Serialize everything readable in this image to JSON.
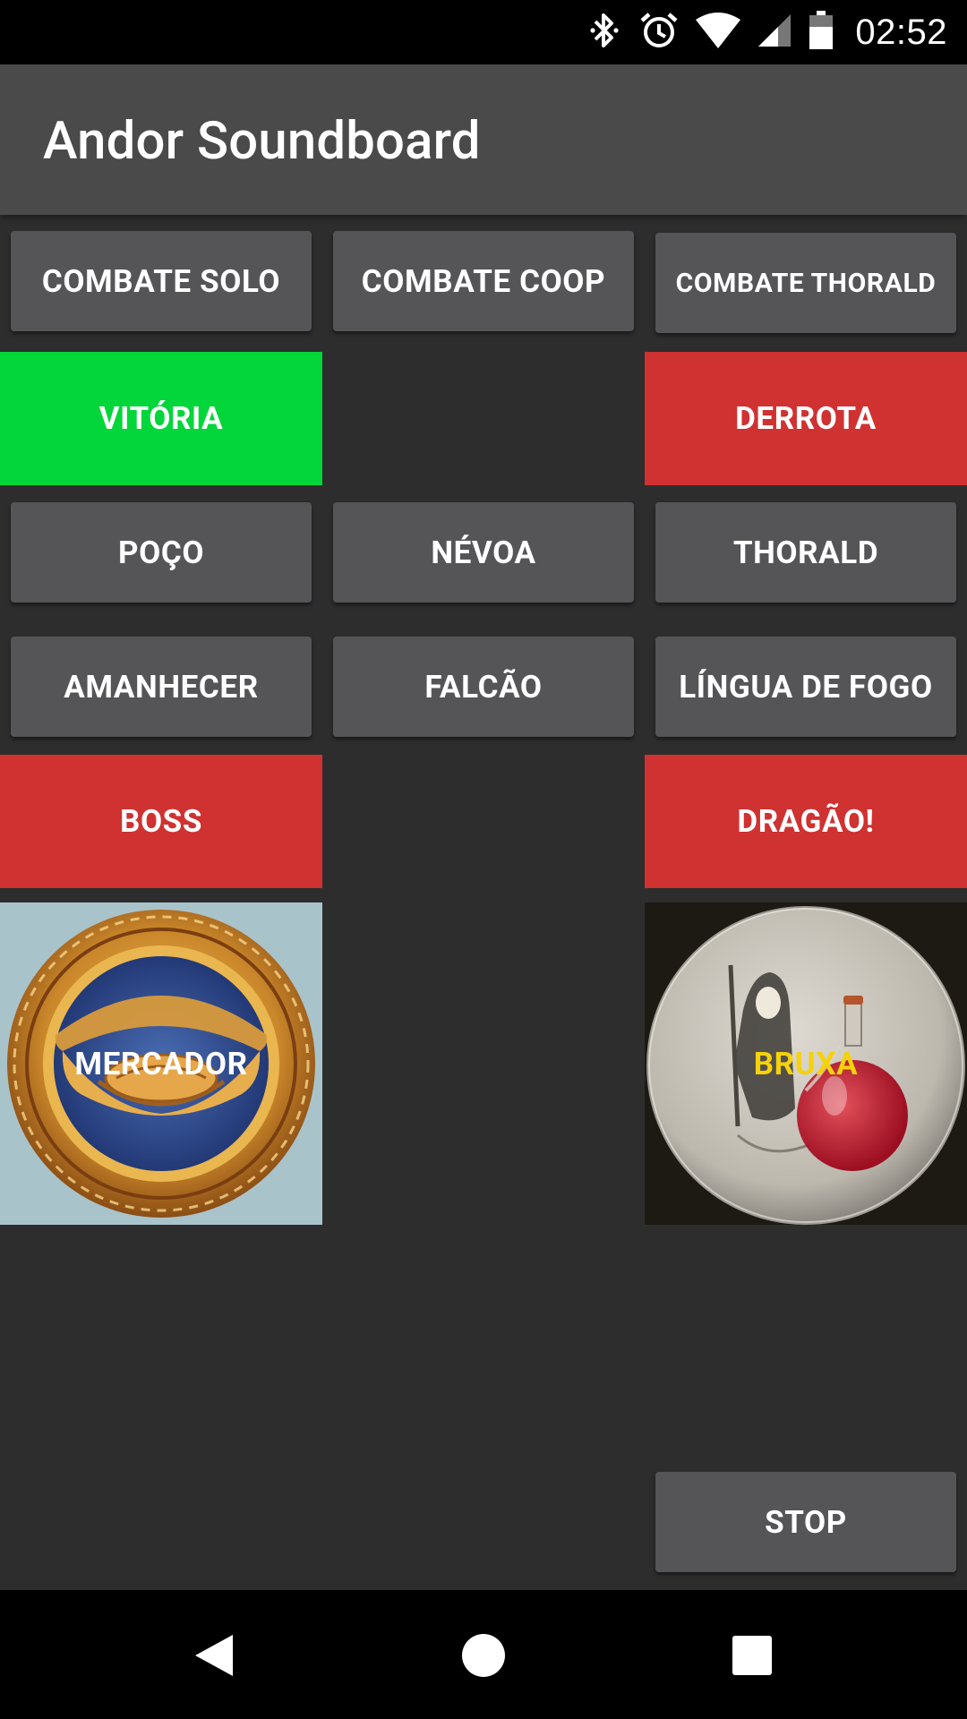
{
  "status_bar": {
    "time": "02:52",
    "icons": [
      "bluetooth-icon",
      "alarm-icon",
      "wifi-icon",
      "cellular-signal-icon",
      "battery-icon"
    ]
  },
  "app_bar": {
    "title": "Andor Soundboard"
  },
  "buttons": {
    "combate_solo": "COMBATE SOLO",
    "combate_coop": "COMBATE COOP",
    "combate_thorald": "COMBATE THORALD",
    "vitoria": "VITÓRIA",
    "derrota": "DERROTA",
    "poco": "POÇO",
    "nevoa": "NÉVOA",
    "thorald": "THORALD",
    "amanhecer": "AMANHECER",
    "falcao": "FALCÃO",
    "lingua_de_fogo": "LÍNGUA DE FOGO",
    "boss": "BOSS",
    "dragao": "DRAGÃO!",
    "mercador": "MERCADOR",
    "bruxa": "BRUXA",
    "stop": "STOP"
  },
  "colors": {
    "app_bar": "#4a4a4a",
    "background": "#2d2d2d",
    "button_gray": "#555557",
    "victory_green": "#02d63a",
    "danger_red": "#d03131",
    "bruxa_label": "#f5d20a"
  },
  "nav_bar": {
    "icons": [
      "back-icon",
      "home-icon",
      "recents-icon"
    ]
  }
}
